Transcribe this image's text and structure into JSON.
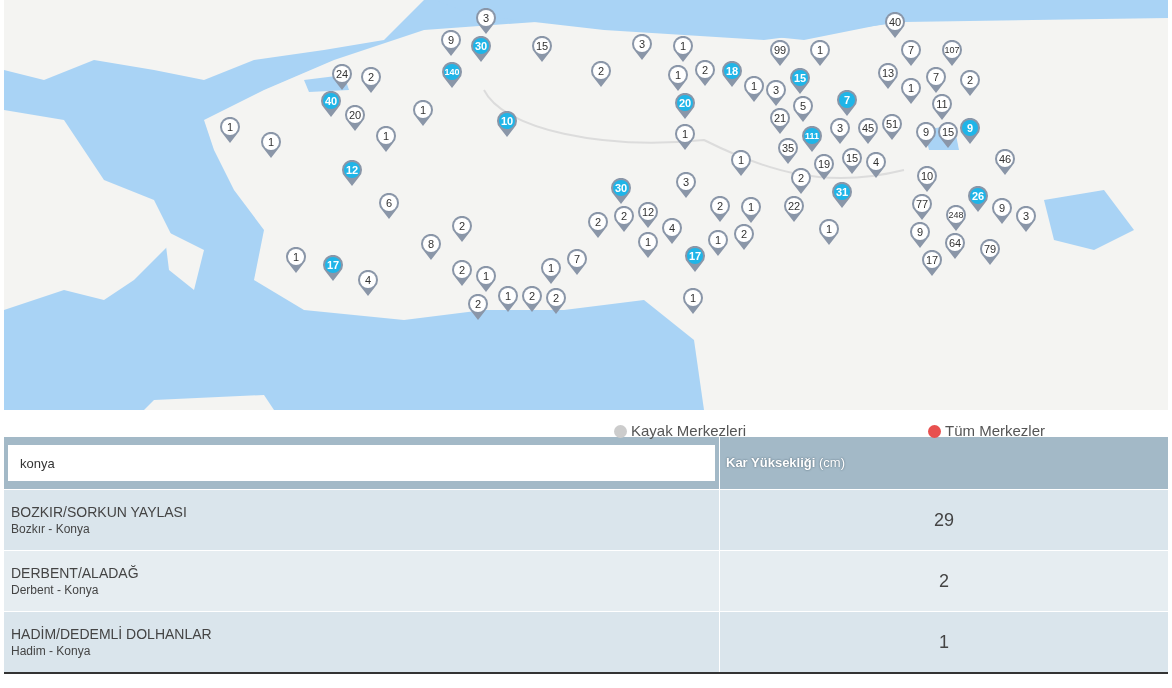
{
  "map": {
    "kind": "picture",
    "pins": [
      {
        "label": "3",
        "kind": "gray"
      },
      {
        "label": "40",
        "kind": "gray"
      },
      {
        "label": "9",
        "kind": "gray"
      },
      {
        "label": "30",
        "kind": "blue"
      },
      {
        "label": "15",
        "kind": "gray"
      },
      {
        "label": "3",
        "kind": "gray"
      },
      {
        "label": "1",
        "kind": "gray"
      },
      {
        "label": "99",
        "kind": "gray"
      },
      {
        "label": "1",
        "kind": "gray"
      },
      {
        "label": "7",
        "kind": "gray"
      },
      {
        "label": "107",
        "kind": "gray"
      },
      {
        "label": "24",
        "kind": "gray"
      },
      {
        "label": "2",
        "kind": "gray"
      },
      {
        "label": "140",
        "kind": "blue"
      },
      {
        "label": "2",
        "kind": "gray"
      },
      {
        "label": "1",
        "kind": "gray"
      },
      {
        "label": "2",
        "kind": "gray"
      },
      {
        "label": "18",
        "kind": "blue"
      },
      {
        "label": "1",
        "kind": "gray"
      },
      {
        "label": "3",
        "kind": "gray"
      },
      {
        "label": "15",
        "kind": "blue"
      },
      {
        "label": "13",
        "kind": "gray"
      },
      {
        "label": "1",
        "kind": "gray"
      },
      {
        "label": "7",
        "kind": "gray"
      },
      {
        "label": "2",
        "kind": "gray"
      },
      {
        "label": "40",
        "kind": "blue"
      },
      {
        "label": "20",
        "kind": "gray"
      },
      {
        "label": "1",
        "kind": "gray"
      },
      {
        "label": "10",
        "kind": "blue"
      },
      {
        "label": "20",
        "kind": "blue"
      },
      {
        "label": "21",
        "kind": "gray"
      },
      {
        "label": "5",
        "kind": "gray"
      },
      {
        "label": "7",
        "kind": "blue"
      },
      {
        "label": "51",
        "kind": "gray"
      },
      {
        "label": "11",
        "kind": "gray"
      },
      {
        "label": "1",
        "kind": "gray"
      },
      {
        "label": "1",
        "kind": "gray"
      },
      {
        "label": "1",
        "kind": "gray"
      },
      {
        "label": "1",
        "kind": "gray"
      },
      {
        "label": "111",
        "kind": "blue"
      },
      {
        "label": "3",
        "kind": "gray"
      },
      {
        "label": "45",
        "kind": "gray"
      },
      {
        "label": "9",
        "kind": "gray"
      },
      {
        "label": "15",
        "kind": "gray"
      },
      {
        "label": "9",
        "kind": "blue"
      },
      {
        "label": "1",
        "kind": "gray"
      },
      {
        "label": "35",
        "kind": "gray"
      },
      {
        "label": "19",
        "kind": "gray"
      },
      {
        "label": "15",
        "kind": "gray"
      },
      {
        "label": "4",
        "kind": "gray"
      },
      {
        "label": "46",
        "kind": "gray"
      },
      {
        "label": "12",
        "kind": "blue"
      },
      {
        "label": "3",
        "kind": "gray"
      },
      {
        "label": "2",
        "kind": "gray"
      },
      {
        "label": "10",
        "kind": "gray"
      },
      {
        "label": "6",
        "kind": "gray"
      },
      {
        "label": "30",
        "kind": "blue"
      },
      {
        "label": "2",
        "kind": "gray"
      },
      {
        "label": "12",
        "kind": "gray"
      },
      {
        "label": "2",
        "kind": "gray"
      },
      {
        "label": "1",
        "kind": "gray"
      },
      {
        "label": "22",
        "kind": "gray"
      },
      {
        "label": "31",
        "kind": "blue"
      },
      {
        "label": "77",
        "kind": "gray"
      },
      {
        "label": "248",
        "kind": "gray"
      },
      {
        "label": "26",
        "kind": "blue"
      },
      {
        "label": "9",
        "kind": "gray"
      },
      {
        "label": "3",
        "kind": "gray"
      },
      {
        "label": "1",
        "kind": "gray"
      },
      {
        "label": "8",
        "kind": "gray"
      },
      {
        "label": "2",
        "kind": "gray"
      },
      {
        "label": "7",
        "kind": "gray"
      },
      {
        "label": "2",
        "kind": "gray"
      },
      {
        "label": "1",
        "kind": "gray"
      },
      {
        "label": "4",
        "kind": "gray"
      },
      {
        "label": "17",
        "kind": "blue"
      },
      {
        "label": "1",
        "kind": "gray"
      },
      {
        "label": "2",
        "kind": "gray"
      },
      {
        "label": "1",
        "kind": "gray"
      },
      {
        "label": "9",
        "kind": "gray"
      },
      {
        "label": "17",
        "kind": "gray"
      },
      {
        "label": "64",
        "kind": "gray"
      },
      {
        "label": "79",
        "kind": "gray"
      },
      {
        "label": "17",
        "kind": "blue"
      },
      {
        "label": "4",
        "kind": "gray"
      },
      {
        "label": "2",
        "kind": "gray"
      },
      {
        "label": "1",
        "kind": "gray"
      },
      {
        "label": "1",
        "kind": "gray"
      },
      {
        "label": "2",
        "kind": "gray"
      },
      {
        "label": "1",
        "kind": "gray"
      },
      {
        "label": "2",
        "kind": "gray"
      },
      {
        "label": "2",
        "kind": "gray"
      },
      {
        "label": "1",
        "kind": "gray"
      }
    ]
  },
  "legend": [
    {
      "label": "Kayak Merkezleri",
      "color": "#cccccc"
    },
    {
      "label": "Tüm Merkezler",
      "color": "#e8504f"
    }
  ],
  "table": {
    "search": {
      "value": "konya"
    },
    "column_header": "**Kar Yüksekliği** (cm)",
    "rows": [
      {
        "name": "BOZKIR/SORKUN YAYLASI",
        "location": "Bozkır - Konya",
        "depth": "29"
      },
      {
        "name": "DERBENT/ALADAĞ",
        "location": "Derbent - Konya",
        "depth": "2"
      },
      {
        "name": "HADİM/DEDEMLİ DOLHANLAR",
        "location": "Hadim - Konya",
        "depth": "1"
      }
    ]
  }
}
